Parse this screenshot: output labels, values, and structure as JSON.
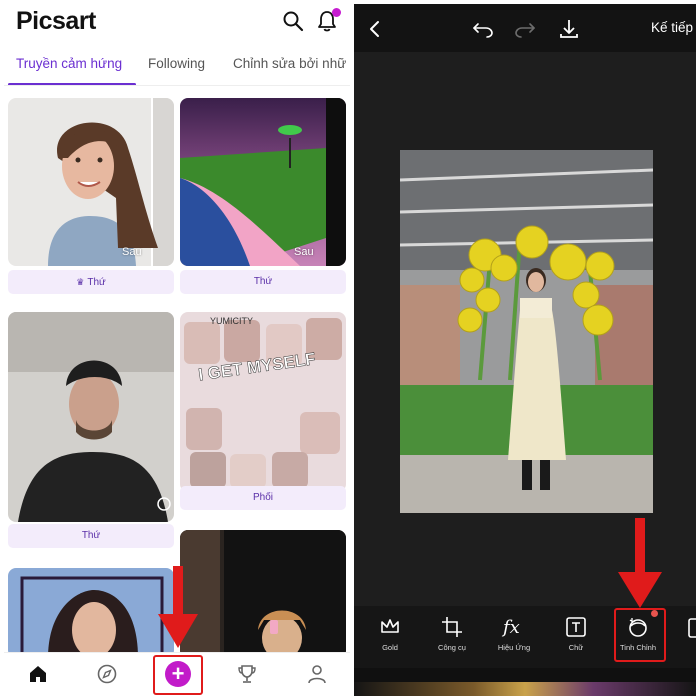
{
  "left_app": {
    "logo": "Picsart",
    "tabs": [
      "Truyền cảm hứng",
      "Following",
      "Chỉnh sửa bởi nhữ"
    ],
    "active_tab": 0,
    "cards": [
      {
        "label": "Thứ",
        "premium": true,
        "overlay": "Sau"
      },
      {
        "label": "Thứ",
        "premium": false,
        "overlay": "Sau"
      },
      {
        "label": "Thứ",
        "premium": false,
        "overlay": ""
      },
      {
        "label": "Phối",
        "premium": false,
        "overlay": ""
      }
    ],
    "collage_text": [
      "YUMICITY",
      "I GET MYSELF"
    ],
    "bottom_nav": [
      "home-icon",
      "discover-icon",
      "plus-icon",
      "trophy-icon",
      "profile-icon"
    ],
    "colors": {
      "accent": "#6b2fd1",
      "plus": "#c21bc9",
      "highlight": "#e01b1b"
    }
  },
  "right_app": {
    "header": {
      "next_label": "Kế tiếp"
    },
    "tools": [
      {
        "icon": "gold-crown-icon",
        "label": "Gold"
      },
      {
        "icon": "crop-icon",
        "label": "Công cụ"
      },
      {
        "icon": "fx-icon",
        "label": "Hiệu Ứng"
      },
      {
        "icon": "text-icon",
        "label": "Chữ"
      },
      {
        "icon": "retouch-face-icon",
        "label": "Tinh Chỉnh"
      }
    ],
    "highlighted_tool": 4,
    "colors": {
      "background": "#1b1b1b",
      "badge": "#e8544e"
    }
  }
}
